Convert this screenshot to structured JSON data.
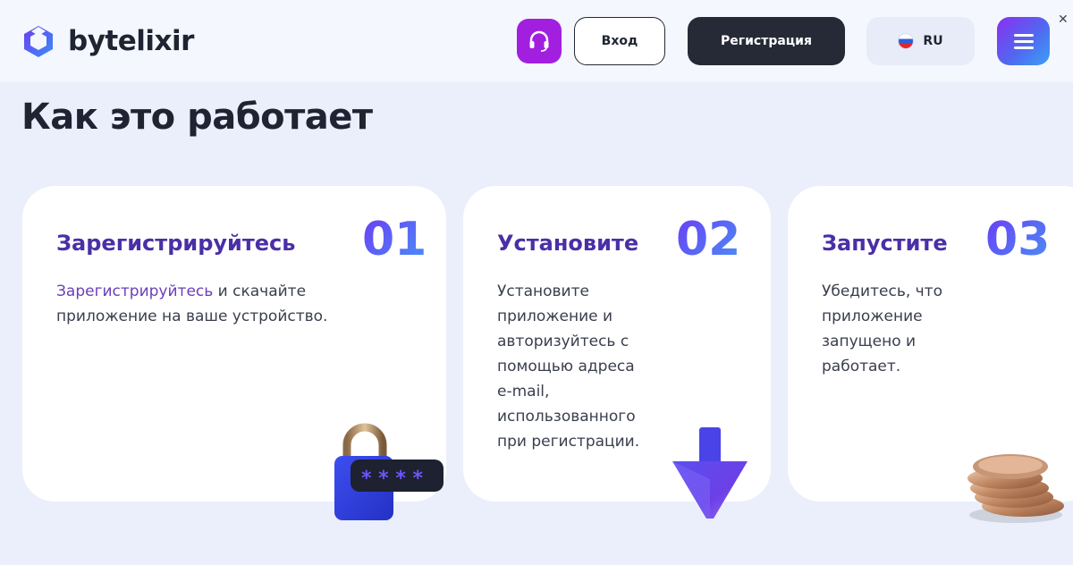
{
  "header": {
    "brand": "bytelixir",
    "login_label": "Вход",
    "register_label": "Регистрация",
    "lang_label": "RU",
    "close_glyph": "✕"
  },
  "section": {
    "title": "Как это работает"
  },
  "steps": [
    {
      "title": "Зарегистрируйтесь",
      "number": "01",
      "link_text": "Зарегистрируйтесь",
      "text": " и скачайте приложение на ваше устройство."
    },
    {
      "title": "Установите",
      "number": "02",
      "text": "Установите приложение и авторизуйтесь с помощью адреса e-mail, использованного при регистрации."
    },
    {
      "title": "Запустите",
      "number": "03",
      "text": "Убедитесь, что приложение запущено и работает."
    }
  ],
  "colors": {
    "brand_purple": "#a21fe0",
    "dark_button": "#262a37",
    "title_purple": "#4a2fa6",
    "number_gradient_start": "#6a3ef5",
    "number_gradient_end": "#4a8ff7",
    "page_background": "#eaeffb"
  },
  "icons": {
    "support": "headset-icon",
    "menu": "hamburger-menu-icon",
    "lang_flag": "russia-flag-icon",
    "step1": "padlock-password-icon",
    "step2": "download-arrow-icon",
    "step3": "coins-stack-icon"
  }
}
